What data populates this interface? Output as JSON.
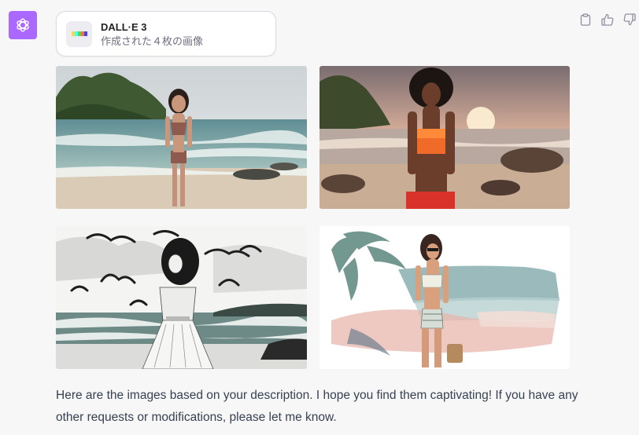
{
  "assistant": {
    "avatar_icon": "openai-logo-icon",
    "avatar_color": "#ab68ff"
  },
  "actions": [
    {
      "icon": "clipboard-icon",
      "label": "Copy"
    },
    {
      "icon": "thumbs-up-icon",
      "label": "Good response"
    },
    {
      "icon": "thumbs-down-icon",
      "label": "Bad response"
    }
  ],
  "dalle_card": {
    "title": "DALL·E 3",
    "subtitle": "作成された４枚の画像",
    "icon": "dalle-palette-icon"
  },
  "images": [
    {
      "subject": "woman-in-brown-bikini-on-tropical-beach"
    },
    {
      "subject": "woman-in-orange-bikini-at-sunset-beach"
    },
    {
      "subject": "sketch-woman-in-white-dress-with-seagulls"
    },
    {
      "subject": "watercolor-woman-in-sunglasses-on-beach"
    }
  ],
  "message": {
    "text": "Here are the images based on your description. I hope you find them captivating! If you have any other requests or modifications, please let me know."
  }
}
